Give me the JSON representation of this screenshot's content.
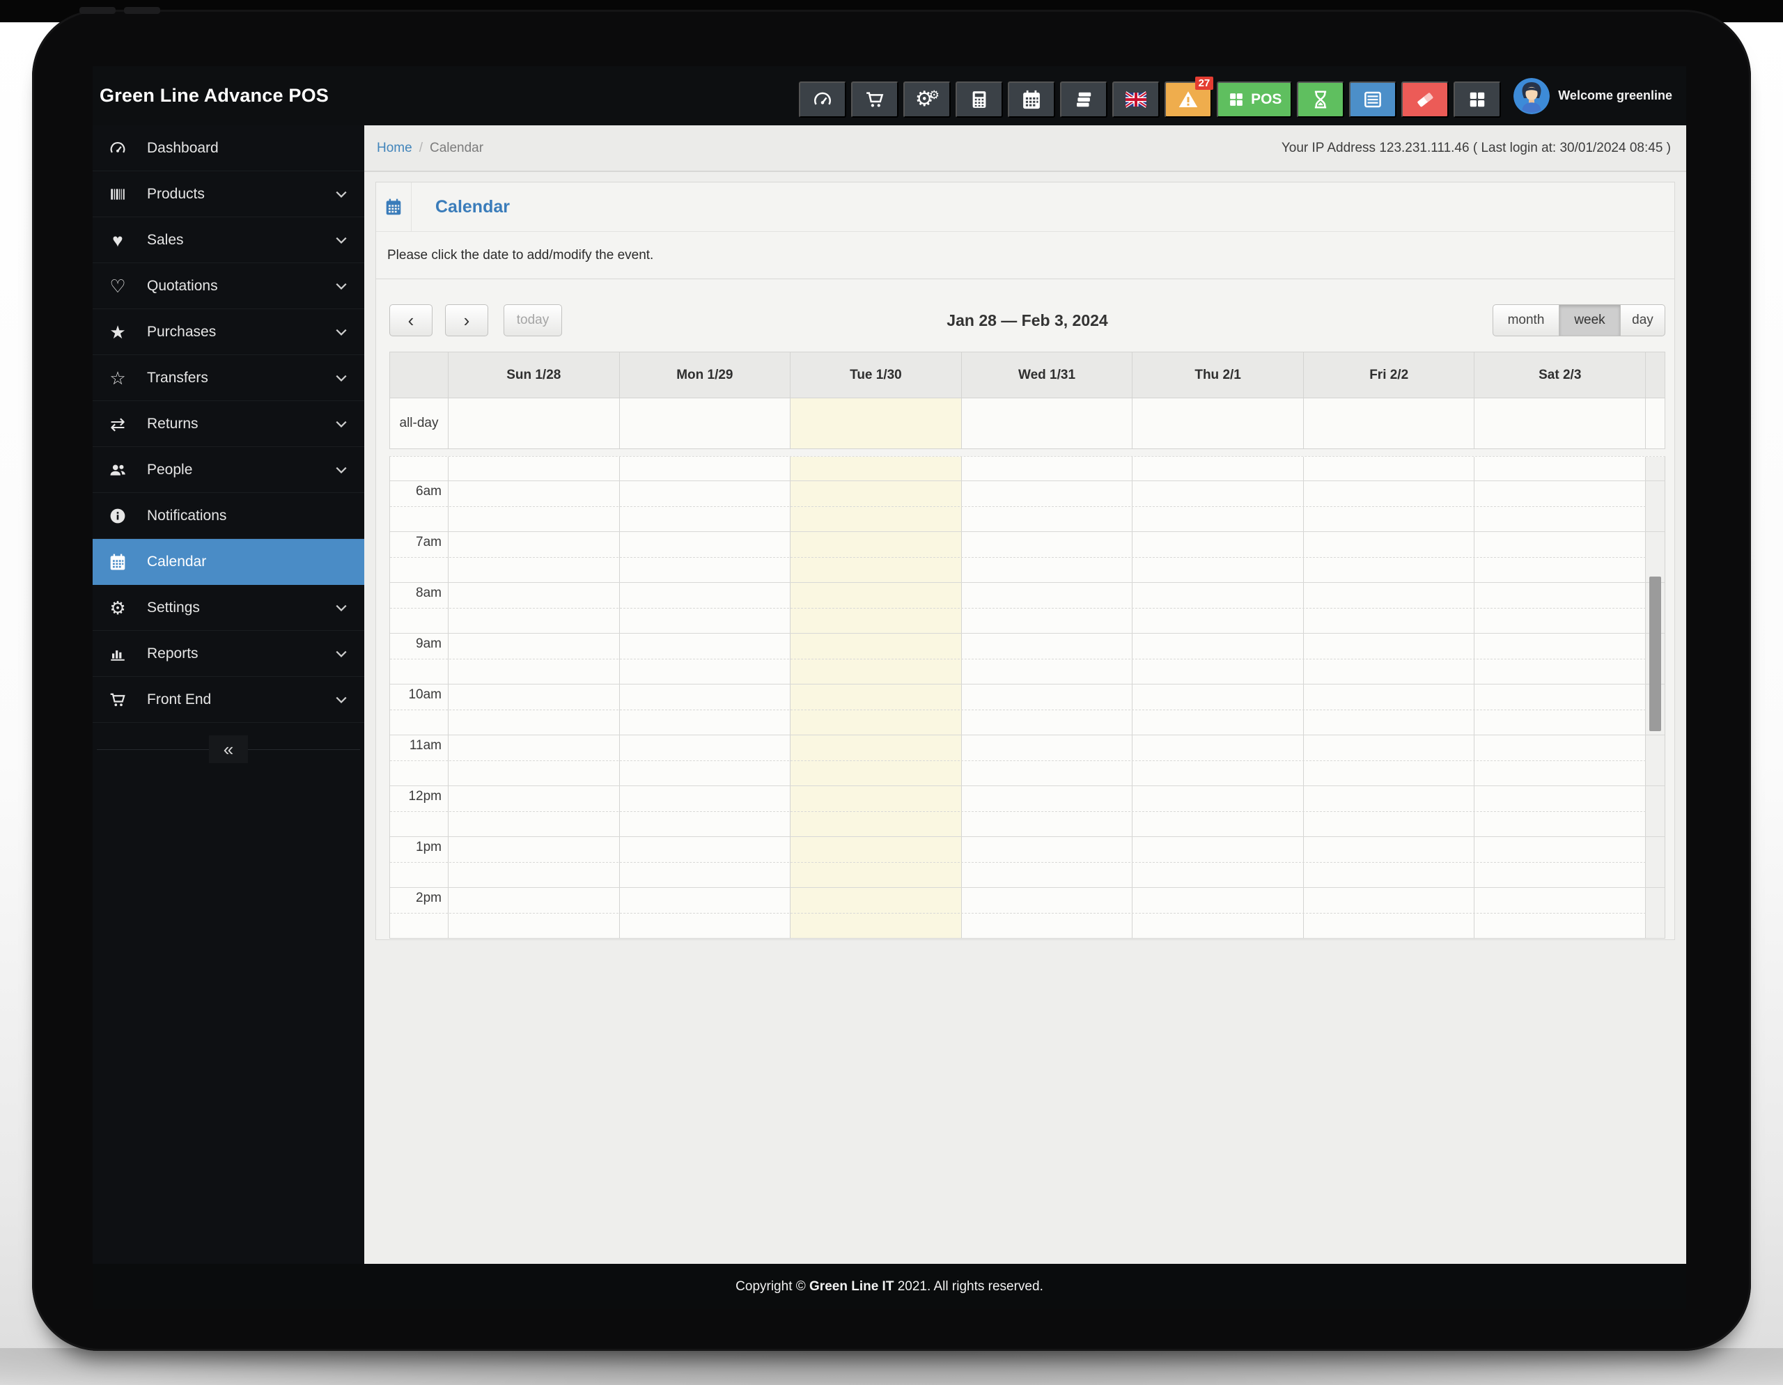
{
  "header": {
    "brand": "Green Line Advance POS",
    "welcome": "Welcome greenline",
    "toolbar": [
      {
        "name": "dashboard-shortcut",
        "icon": "tachometer-icon",
        "style": "dark"
      },
      {
        "name": "cart-shortcut",
        "icon": "cart-icon",
        "style": "dark"
      },
      {
        "name": "settings-shortcut",
        "icon": "cogs-icon",
        "style": "dark"
      },
      {
        "name": "calculator-shortcut",
        "icon": "calculator-icon",
        "style": "dark"
      },
      {
        "name": "calendar-shortcut",
        "icon": "calendar-icon",
        "style": "dark"
      },
      {
        "name": "layers-shortcut",
        "icon": "layers-icon",
        "style": "dark"
      },
      {
        "name": "language-shortcut",
        "icon": "uk-flag-icon",
        "style": "dark"
      },
      {
        "name": "alerts-shortcut",
        "icon": "warning-icon",
        "style": "orange",
        "badge": "27"
      },
      {
        "name": "pos-shortcut",
        "icon": "grid-icon",
        "style": "green",
        "label": "POS"
      },
      {
        "name": "pending-shortcut",
        "icon": "hourglass-icon",
        "style": "green"
      },
      {
        "name": "list-shortcut",
        "icon": "list-icon",
        "style": "blue"
      },
      {
        "name": "eraser-shortcut",
        "icon": "eraser-icon",
        "style": "red"
      },
      {
        "name": "apps-shortcut",
        "icon": "grid-icon",
        "style": "dark"
      }
    ]
  },
  "sidebar": {
    "items": [
      {
        "label": "Dashboard",
        "icon": "tachometer-icon",
        "active": false,
        "has_submenu": false
      },
      {
        "label": "Products",
        "icon": "barcode-icon",
        "active": false,
        "has_submenu": true
      },
      {
        "label": "Sales",
        "icon": "heart-icon",
        "active": false,
        "has_submenu": true
      },
      {
        "label": "Quotations",
        "icon": "heart-outline-icon",
        "active": false,
        "has_submenu": true
      },
      {
        "label": "Purchases",
        "icon": "star-icon",
        "active": false,
        "has_submenu": true
      },
      {
        "label": "Transfers",
        "icon": "star-outline-icon",
        "active": false,
        "has_submenu": true
      },
      {
        "label": "Returns",
        "icon": "shuffle-icon",
        "active": false,
        "has_submenu": true
      },
      {
        "label": "People",
        "icon": "users-icon",
        "active": false,
        "has_submenu": true
      },
      {
        "label": "Notifications",
        "icon": "info-icon",
        "active": false,
        "has_submenu": false
      },
      {
        "label": "Calendar",
        "icon": "calendar-icon",
        "active": true,
        "has_submenu": false
      },
      {
        "label": "Settings",
        "icon": "gear-icon",
        "active": false,
        "has_submenu": true
      },
      {
        "label": "Reports",
        "icon": "bar-chart-icon",
        "active": false,
        "has_submenu": true
      },
      {
        "label": "Front End",
        "icon": "cart-icon",
        "active": false,
        "has_submenu": true
      }
    ],
    "collapse_label": "«"
  },
  "breadcrumb": {
    "home": "Home",
    "separator": "/",
    "current": "Calendar"
  },
  "status": {
    "ip_text": "Your IP Address 123.231.111.46 ( Last login at: 30/01/2024 08:45 )"
  },
  "calendar": {
    "panel_title": "Calendar",
    "note": "Please click the date to add/modify the event.",
    "nav": {
      "prev": "‹",
      "next": "›",
      "today": "today"
    },
    "title": "Jan 28 — Feb 3, 2024",
    "views": [
      {
        "label": "month",
        "active": false
      },
      {
        "label": "week",
        "active": true
      },
      {
        "label": "day",
        "active": false
      }
    ],
    "all_day_label": "all-day",
    "days": [
      {
        "label": "Sun 1/28",
        "today": false
      },
      {
        "label": "Mon 1/29",
        "today": false
      },
      {
        "label": "Tue 1/30",
        "today": true
      },
      {
        "label": "Wed 1/31",
        "today": false
      },
      {
        "label": "Thu 2/1",
        "today": false
      },
      {
        "label": "Fri 2/2",
        "today": false
      },
      {
        "label": "Sat 2/3",
        "today": false
      }
    ],
    "times": [
      "6am",
      "7am",
      "8am",
      "9am",
      "10am",
      "11am",
      "12pm",
      "1pm",
      "2pm"
    ]
  },
  "footer": {
    "prefix": "Copyright © ",
    "company": "Green Line IT",
    "suffix": " 2021. All rights reserved."
  },
  "colors": {
    "accent_blue": "#4a8cc6",
    "link_blue": "#4285bb",
    "panel_title_blue": "#3a7cba",
    "tile_orange": "#efad4d",
    "tile_green": "#5fbf5f",
    "tile_blue": "#4c8fc9",
    "tile_red": "#ec5b57",
    "badge_red": "#e43d32",
    "today_highlight": "#faf7e1"
  }
}
